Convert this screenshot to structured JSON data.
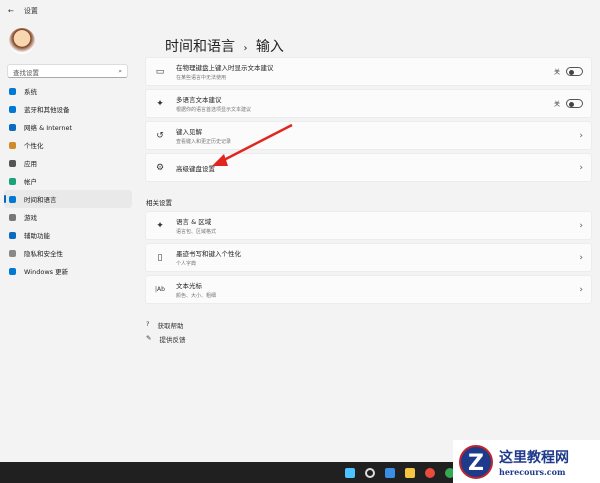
{
  "window": {
    "back": "←",
    "title": "设置"
  },
  "search": {
    "placeholder": "查找设置",
    "icon": "⌕"
  },
  "sidebar": {
    "items": [
      {
        "label": "系统",
        "color": "#0078d4"
      },
      {
        "label": "蓝牙和其他设备",
        "color": "#0078d4"
      },
      {
        "label": "网络 & Internet",
        "color": "#0a6bbf"
      },
      {
        "label": "个性化",
        "color": "#d08b2a"
      },
      {
        "label": "应用",
        "color": "#555555"
      },
      {
        "label": "帐户",
        "color": "#1aa37a"
      },
      {
        "label": "时间和语言",
        "color": "#0078d4",
        "selected": true
      },
      {
        "label": "游戏",
        "color": "#777777"
      },
      {
        "label": "辅助功能",
        "color": "#0a6bbf"
      },
      {
        "label": "隐私和安全性",
        "color": "#888888"
      },
      {
        "label": "Windows 更新",
        "color": "#0078d4"
      }
    ]
  },
  "header": {
    "parent": "时间和语言",
    "sep": "›",
    "current": "输入"
  },
  "settings": [
    {
      "icon": "▭",
      "title": "在物理键盘上键入时显示文本建议",
      "sub": "在某些语言中无法使用",
      "toggle": "关"
    },
    {
      "icon": "✦",
      "title": "多语言文本建议",
      "sub": "根据你的语言首选项显示文本建议",
      "toggle": "关"
    },
    {
      "icon": "↺",
      "title": "键入见解",
      "sub": "查看键入和更正历史记录",
      "chevron": "›"
    },
    {
      "icon": "⚙",
      "title": "高级键盘设置",
      "chevron": "›"
    }
  ],
  "related": {
    "title": "相关设置",
    "items": [
      {
        "icon": "✦",
        "title": "语言 & 区域",
        "sub": "语言包、区域格式",
        "chevron": "›"
      },
      {
        "icon": "▯",
        "title": "墨迹书写和键入个性化",
        "sub": "个人字典",
        "chevron": "›"
      },
      {
        "icon": "|Ab",
        "title": "文本光标",
        "sub": "颜色、大小、粗细",
        "chevron": "›"
      }
    ]
  },
  "links": [
    {
      "icon": "?",
      "label": "获取帮助"
    },
    {
      "icon": "✎",
      "label": "提供反馈"
    }
  ],
  "watermark": {
    "name": "这里教程网",
    "url": "herecours.com",
    "letter": "Z"
  },
  "annotation_color": "#e0261f"
}
